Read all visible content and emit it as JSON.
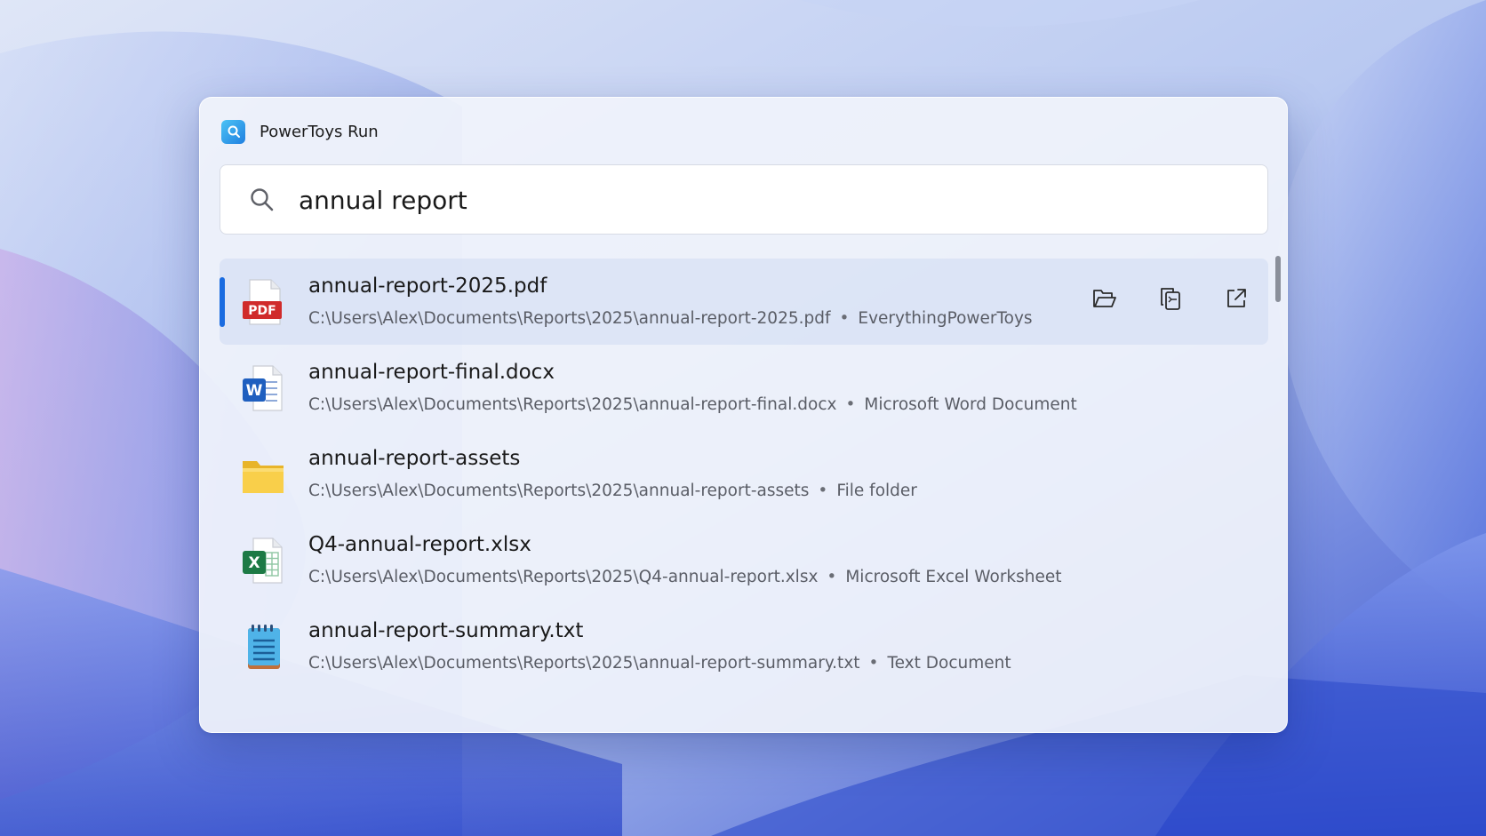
{
  "window": {
    "title": "PowerToys Run",
    "app_icon": "powertoys-run-icon"
  },
  "search": {
    "icon": "search-icon",
    "value": "annual report",
    "placeholder": ""
  },
  "results": [
    {
      "name": "annual-report-2025.pdf",
      "path": "C:\\Users\\Alex\\Documents\\Reports\\2025\\annual-report-2025.pdf",
      "type": "EverythingPowerToys",
      "icon": "pdf-file-icon",
      "selected": true
    },
    {
      "name": "annual-report-final.docx",
      "path": "C:\\Users\\Alex\\Documents\\Reports\\2025\\annual-report-final.docx",
      "type": "Microsoft Word Document",
      "icon": "word-document-icon",
      "selected": false
    },
    {
      "name": "annual-report-assets",
      "path": "C:\\Users\\Alex\\Documents\\Reports\\2025\\annual-report-assets",
      "type": "File folder",
      "icon": "folder-icon",
      "selected": false
    },
    {
      "name": "Q4-annual-report.xlsx",
      "path": "C:\\Users\\Alex\\Documents\\Reports\\2025\\Q4-annual-report.xlsx",
      "type": "Microsoft Excel Worksheet",
      "icon": "excel-worksheet-icon",
      "selected": false
    },
    {
      "name": "annual-report-summary.txt",
      "path": "C:\\Users\\Alex\\Documents\\Reports\\2025\\annual-report-summary.txt",
      "type": "Text Document",
      "icon": "text-document-icon",
      "selected": false
    }
  ],
  "separator": "•",
  "actions": [
    {
      "icon": "open-folder-icon"
    },
    {
      "icon": "copy-path-icon"
    },
    {
      "icon": "open-external-icon"
    }
  ],
  "colors": {
    "accent": "#1a6be0",
    "selected_row": "#d7e0f4",
    "text_primary": "#1a1a1a",
    "text_secondary": "#5a5d66"
  }
}
